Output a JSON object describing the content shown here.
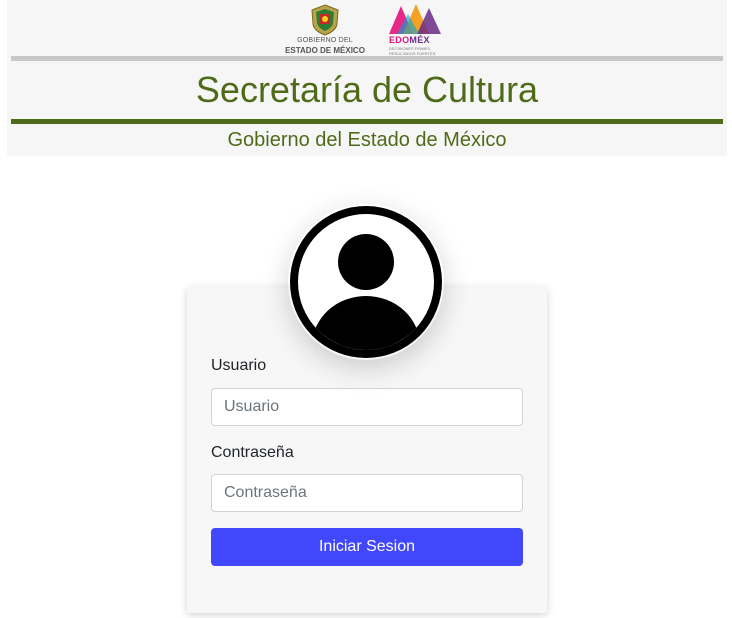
{
  "header": {
    "logo_gobierno": {
      "line1": "GOBIERNO DEL",
      "line2": "ESTADO DE MÉXICO"
    },
    "logo_edomex": {
      "brand_a": "EDO",
      "brand_b": "MÉX",
      "tagline": "DECISIONES FIRMES, RESULTADOS FUERTES."
    },
    "title": "Secretaría de Cultura",
    "subtitle": "Gobierno del Estado de México"
  },
  "login": {
    "user_label": "Usuario",
    "user_placeholder": "Usuario",
    "user_value": "",
    "password_label": "Contraseña",
    "password_placeholder": "Contraseña",
    "password_value": "",
    "submit_label": "Iniciar Sesion"
  },
  "colors": {
    "accent_green": "#4f6b1a",
    "button_blue": "#4147fb"
  },
  "icons": {
    "avatar": "user-circle-icon",
    "emblem": "coat-of-arms-logo",
    "edomex": "edomex-logo"
  }
}
